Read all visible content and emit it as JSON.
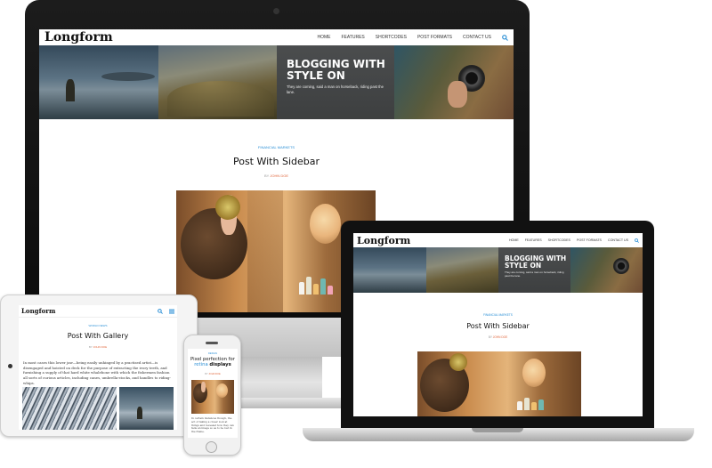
{
  "site": {
    "logo": "Longform",
    "nav": [
      "HOME",
      "FEATURES",
      "SHORTCODES",
      "POST FORMATS",
      "CONTACT US"
    ],
    "search_icon": "search-icon",
    "menu_icon": "hamburger-icon"
  },
  "hero": {
    "title_desktop": "BLOGGING WITH STYLE ON",
    "title_laptop": "BLOGGING WITH STYLE ON",
    "subtitle": "They are coming, said a man on horseback, riding past the lane."
  },
  "desktop_post": {
    "category": "FINANCIAL MARKETS",
    "title": "Post With Sidebar",
    "by": "BY",
    "author": "JOHN DOE"
  },
  "laptop_post": {
    "category": "FINANCIAL MARKETS",
    "title": "Post With Sidebar",
    "by": "BY",
    "author": "JOHN DOE"
  },
  "tablet_post": {
    "category": "WORLD NEWS",
    "title": "Post With Gallery",
    "by": "BY",
    "author": "JOHN DOE",
    "excerpt": "In most cases this lower jaw—being easily unhinged by a practised artist—is disengaged and hoisted on deck for the purpose of extracting the ivory teeth, and furnishing a supply of that hard white whalebone with which the fishermen fashion all sorts of curious articles, including canes, umbrella-stocks, and handles to riding-whips."
  },
  "phone_post": {
    "category": "DESIGN",
    "title_line1": "Pixel perfection for",
    "title_line2_a": "retina",
    "title_line2_b": "displays",
    "by": "BY",
    "author": "JOHN DOE",
    "excerpt": "In certain instances though, the act of taking a closer look at things and revealed how they can fade an image so as to be lost in the frame."
  },
  "colors": {
    "accent": "#2a8fd6",
    "author": "#e0653a",
    "device_dark": "#111111",
    "device_silver": "#c9c9c9"
  }
}
